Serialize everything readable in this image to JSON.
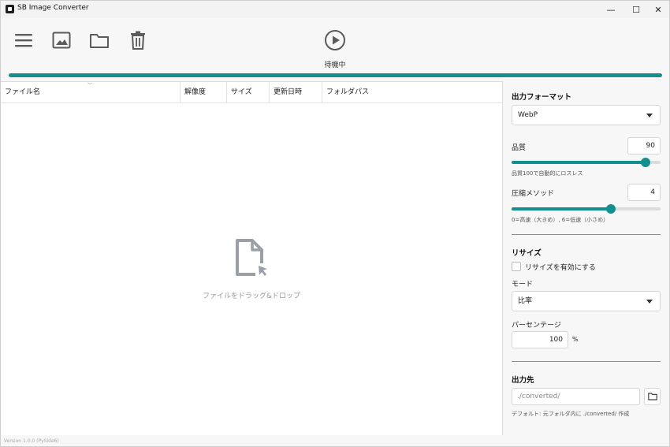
{
  "window": {
    "title": "SB Image Converter",
    "controls": {
      "minimize": "—",
      "maximize": "☐",
      "close": "✕"
    }
  },
  "toolbar": {
    "icons": [
      "menu-icon",
      "image-icon",
      "folder-icon",
      "trash-icon",
      "play-icon"
    ],
    "status": "待機中",
    "progress_fraction": 1.0
  },
  "table": {
    "columns": [
      "ファイル名",
      "解像度",
      "サイズ",
      "更新日時",
      "フォルダパス"
    ],
    "rows": [],
    "empty_text": "ファイルをドラッグ&ドロップ"
  },
  "settings": {
    "format": {
      "title": "出力フォーマット",
      "selected": "WebP"
    },
    "quality": {
      "label": "品質",
      "value": "90",
      "fraction": 0.9,
      "hint": "品質100で自動的にロスレス"
    },
    "method": {
      "label": "圧縮メソッド",
      "value": "4",
      "fraction": 0.6667,
      "hint": "0=高速（大きめ）, 6=低速（小さめ）"
    },
    "resize": {
      "title": "リサイズ",
      "enable_label": "リサイズを有効にする",
      "enabled": false,
      "mode_label": "モード",
      "mode_selected": "比率",
      "percent_label": "パーセンテージ",
      "percent_value": "100",
      "percent_unit": "%"
    },
    "output": {
      "title": "出力先",
      "placeholder": "./converted/",
      "hint": "デフォルト: 元フォルダ内に ./converted/ 作成"
    }
  },
  "footer": {
    "version": "Version 1.0.0 (PySide6)"
  },
  "colors": {
    "accent": "#129090",
    "background": "#f7f7f7",
    "icon": "#5b5b5b",
    "drop_icon": "#9aa0a6"
  }
}
